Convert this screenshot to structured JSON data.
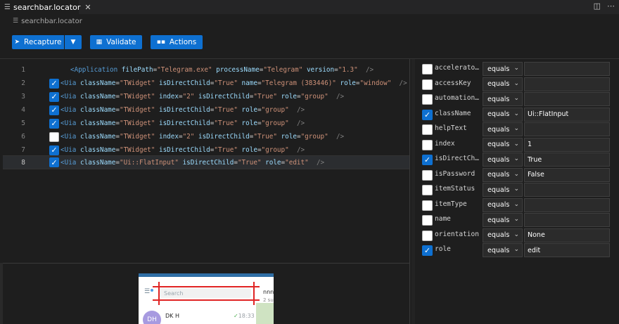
{
  "tab": {
    "title": "searchbar.locator",
    "close": "✕"
  },
  "breadcrumb": {
    "file": "searchbar.locator"
  },
  "toolbar": {
    "recapture": "Recapture",
    "validate": "Validate",
    "actions": "Actions"
  },
  "colors": {
    "accent": "#0e70d1",
    "tag": "#569cd6",
    "attr": "#9cdcfe",
    "value": "#ce9178"
  },
  "editor": {
    "lines": [
      {
        "num": "1",
        "checkable": false,
        "checked": false,
        "tag": "<Application",
        "attrs": [
          [
            "filePath",
            "\"Telegram.exe\""
          ],
          [
            "processName",
            "\"Telegram\""
          ],
          [
            "version",
            "\"1.3\""
          ]
        ]
      },
      {
        "num": "2",
        "checkable": true,
        "checked": true,
        "tag": "<Uia",
        "attrs": [
          [
            "className",
            "\"TWidget\""
          ],
          [
            "isDirectChild",
            "\"True\""
          ],
          [
            "name",
            "\"Telegram (383446)\""
          ],
          [
            "role",
            "\"window\""
          ]
        ]
      },
      {
        "num": "3",
        "checkable": true,
        "checked": true,
        "tag": "<Uia",
        "attrs": [
          [
            "className",
            "\"TWidget\""
          ],
          [
            "index",
            "\"2\""
          ],
          [
            "isDirectChild",
            "\"True\""
          ],
          [
            "role",
            "\"group\""
          ]
        ]
      },
      {
        "num": "4",
        "checkable": true,
        "checked": true,
        "tag": "<Uia",
        "attrs": [
          [
            "className",
            "\"TWidget\""
          ],
          [
            "isDirectChild",
            "\"True\""
          ],
          [
            "role",
            "\"group\""
          ]
        ]
      },
      {
        "num": "5",
        "checkable": true,
        "checked": true,
        "tag": "<Uia",
        "attrs": [
          [
            "className",
            "\"TWidget\""
          ],
          [
            "isDirectChild",
            "\"True\""
          ],
          [
            "role",
            "\"group\""
          ]
        ]
      },
      {
        "num": "6",
        "checkable": true,
        "checked": false,
        "tag": "<Uia",
        "attrs": [
          [
            "className",
            "\"TWidget\""
          ],
          [
            "index",
            "\"2\""
          ],
          [
            "isDirectChild",
            "\"True\""
          ],
          [
            "role",
            "\"group\""
          ]
        ]
      },
      {
        "num": "7",
        "checkable": true,
        "checked": true,
        "tag": "<Uia",
        "attrs": [
          [
            "className",
            "\"TWidget\""
          ],
          [
            "isDirectChild",
            "\"True\""
          ],
          [
            "role",
            "\"group\""
          ]
        ]
      },
      {
        "num": "8",
        "checkable": true,
        "checked": true,
        "active": true,
        "tag": "<Uia",
        "attrs": [
          [
            "className",
            "\"Ui::FlatInput\""
          ],
          [
            "isDirectChild",
            "\"True\""
          ],
          [
            "role",
            "\"edit\""
          ]
        ]
      }
    ],
    "close_tag": "/>"
  },
  "preview": {
    "search_placeholder": "Search",
    "avatar_initials": "DH",
    "chat_name": "DK H",
    "chat_time": "18:33",
    "right_text1": "nnn",
    "right_text2": "2 su"
  },
  "attributes": [
    {
      "checked": false,
      "name": "accelerator…",
      "op": "equals",
      "value": ""
    },
    {
      "checked": false,
      "name": "accessKey",
      "op": "equals",
      "value": ""
    },
    {
      "checked": false,
      "name": "automationId",
      "op": "equals",
      "value": ""
    },
    {
      "checked": true,
      "name": "className",
      "op": "equals",
      "value": "Ui::FlatInput"
    },
    {
      "checked": false,
      "name": "helpText",
      "op": "equals",
      "value": ""
    },
    {
      "checked": false,
      "name": "index",
      "op": "equals",
      "value": "1"
    },
    {
      "checked": true,
      "name": "isDirectChi…",
      "op": "equals",
      "value": "True"
    },
    {
      "checked": false,
      "name": "isPassword",
      "op": "equals",
      "value": "False"
    },
    {
      "checked": false,
      "name": "itemStatus",
      "op": "equals",
      "value": ""
    },
    {
      "checked": false,
      "name": "itemType",
      "op": "equals",
      "value": ""
    },
    {
      "checked": false,
      "name": "name",
      "op": "equals",
      "value": ""
    },
    {
      "checked": false,
      "name": "orientation",
      "op": "equals",
      "value": "None"
    },
    {
      "checked": true,
      "name": "role",
      "op": "equals",
      "value": "edit"
    }
  ]
}
